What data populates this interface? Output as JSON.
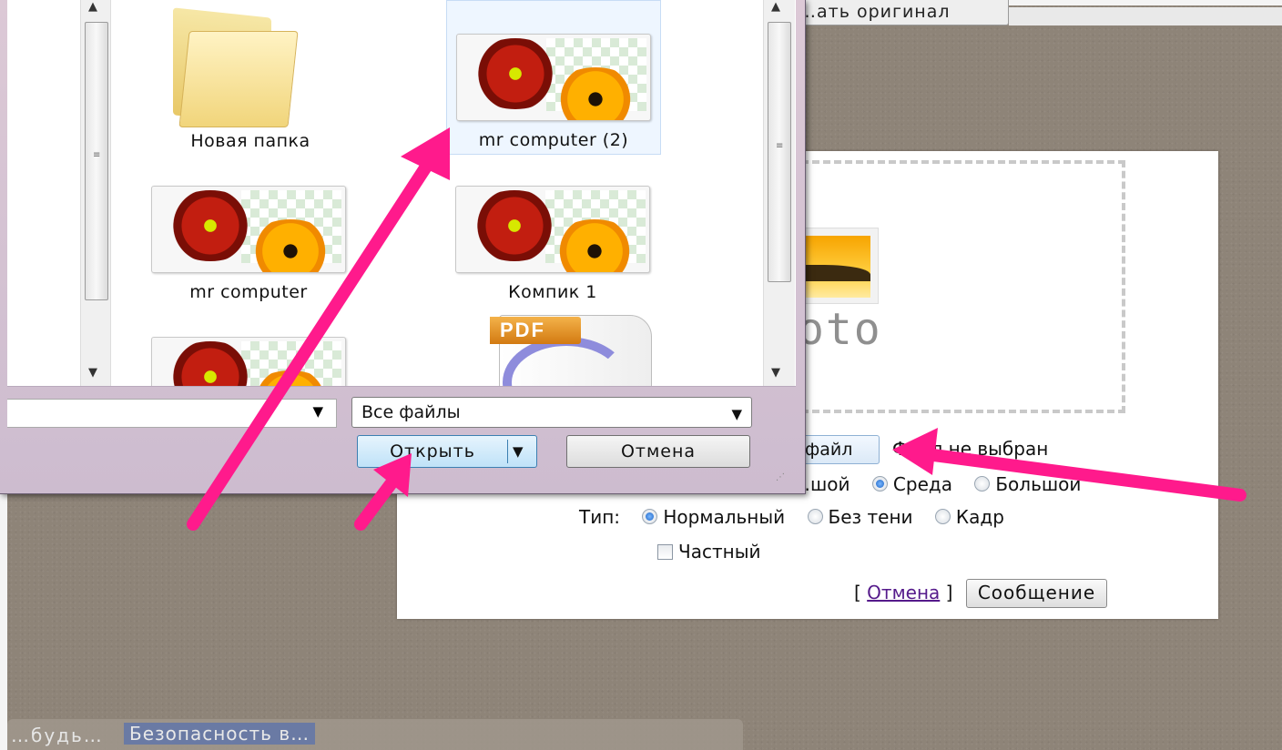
{
  "background_page": {
    "top_button_label": "…ать оригинал"
  },
  "upload_panel": {
    "photo_placeholder_text": "oto",
    "choose_file_button": "файл",
    "file_status": "Файл не выбран",
    "size_options": [
      {
        "label": "…шой",
        "selected": false
      },
      {
        "label": "Среда",
        "selected": true
      },
      {
        "label": "Большой",
        "selected": false
      }
    ],
    "type_label": "Тип:",
    "type_options": [
      {
        "label": "Нормальный",
        "selected": true
      },
      {
        "label": "Без тени",
        "selected": false
      },
      {
        "label": "Кадр",
        "selected": false
      }
    ],
    "private_label": "Частный",
    "cancel_link": "Отмена",
    "message_button": "Сообщение"
  },
  "file_dialog": {
    "items": [
      {
        "name": "Новая папка",
        "kind": "folder-icon"
      },
      {
        "name": "mr computer (2)",
        "kind": "image-thumbnail",
        "selected": true
      },
      {
        "name": "mr computer",
        "kind": "image-thumbnail"
      },
      {
        "name": "Компик 1",
        "kind": "image-thumbnail"
      },
      {
        "name": "",
        "kind": "image-thumbnail"
      },
      {
        "name": "",
        "kind": "pdf-icon",
        "badge": "PDF"
      }
    ],
    "filename_value": "",
    "filetype_value": "Все файлы",
    "open_button": "Открыть",
    "cancel_button": "Отмена"
  },
  "taskbar": {
    "items": [
      "…будь…",
      "Безопасность в…"
    ]
  },
  "colors": {
    "annotation_arrow": "#ff1a8c",
    "desktop_bg": "#8e8478",
    "open_button_bg": "#bfe2f8"
  }
}
